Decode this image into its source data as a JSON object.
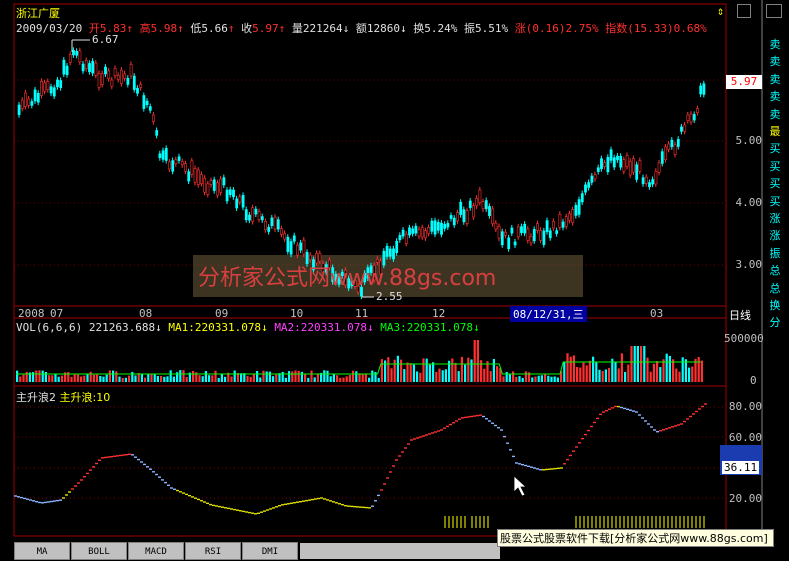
{
  "header": {
    "stock_name": "浙江广厦",
    "date": "2009/03/20",
    "open_label": "开",
    "open": "5.83",
    "high_label": "高",
    "high": "5.98",
    "low_label": "低",
    "low": "5.66",
    "close_label": "收",
    "close": "5.97",
    "volume_label": "量",
    "volume": "221264",
    "amount_label": "额",
    "amount": "12860",
    "turnover_label": "换",
    "turnover": "5.24%",
    "amplitude_label": "振",
    "amplitude": "5.51%",
    "change_label": "涨",
    "change": "(0.16)2.75%",
    "index_label": "指数",
    "index": "(15.33)0.68%"
  },
  "price_axis": {
    "ticks": [
      "5.00",
      "4.00",
      "3.00"
    ],
    "current": "5.97"
  },
  "annotations": {
    "high_mark": "6.67",
    "low_mark": "2.55"
  },
  "watermark": "分析家公式网www.88gs.com",
  "time_axis": {
    "labels": [
      "2008",
      "07",
      "08",
      "09",
      "10",
      "11",
      "12",
      "03"
    ],
    "cursor_date": "08/12/31,三",
    "period": "日线"
  },
  "vol_panel": {
    "title": "VOL(6,6,6)",
    "value": "221263.688",
    "ma1": "MA1:220331.078",
    "ma2": "MA2:220331.078",
    "ma3": "MA3:220331.078",
    "ticks": [
      "500000",
      "0"
    ]
  },
  "ind_panel": {
    "title": "主升浪2",
    "series_label": "主升浪:10",
    "ticks": [
      "80.00",
      "60.00",
      "20.00"
    ],
    "current": "36.11"
  },
  "right_tabs": [
    "卖",
    "卖",
    "卖",
    "卖",
    "卖",
    "最",
    "买",
    "买",
    "买",
    "买",
    "涨",
    "涨",
    "振",
    "总",
    "总",
    "换",
    "分"
  ],
  "bottom_tabs": [
    "MA",
    "BOLL",
    "MACD",
    "RSI",
    "DMI"
  ],
  "bottom_banner": "股票公式股票软件下载[分析家公式网www.88gs.com]",
  "colors": {
    "up": "#ff3030",
    "down": "#00ffff",
    "accent": "#ffff00",
    "bg": "#000000"
  }
}
